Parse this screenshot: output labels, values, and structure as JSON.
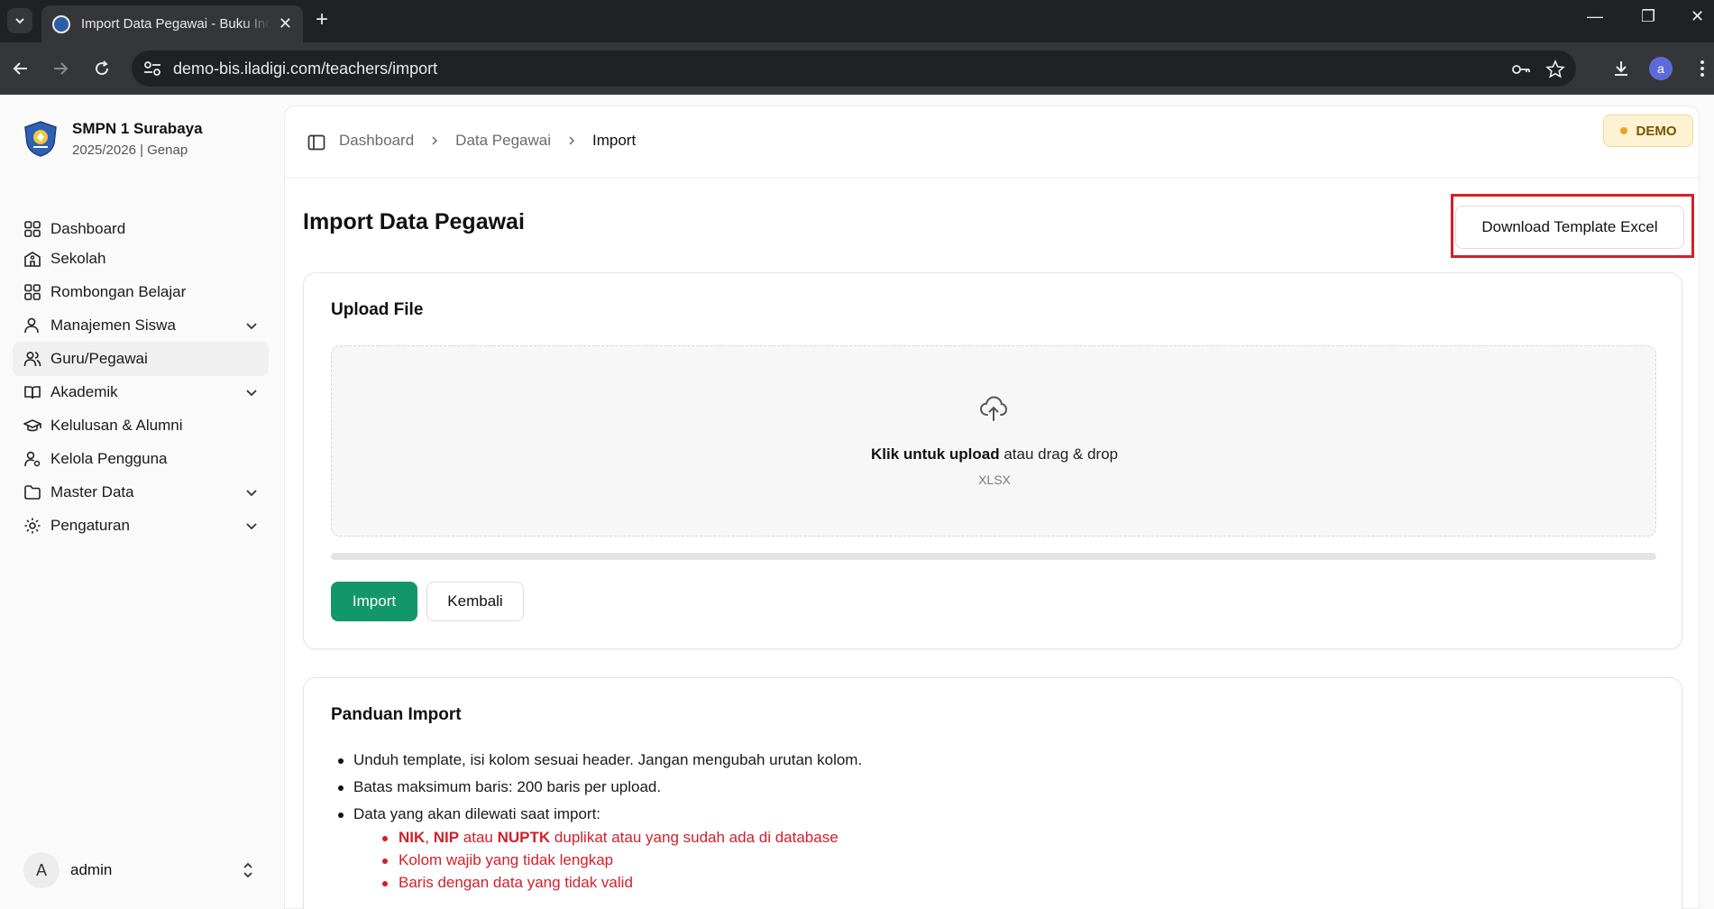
{
  "browser": {
    "tab_title": "Import Data Pegawai - Buku Induk",
    "url": "demo-bis.iladigi.com/teachers/import",
    "profile_initial": "a"
  },
  "sidebar": {
    "school_name": "SMPN 1 Surabaya",
    "school_year": "2025/2026 | Genap",
    "items": [
      {
        "label": "Dashboard",
        "icon": "grid-icon"
      },
      {
        "label": "Sekolah",
        "icon": "school-building-icon"
      },
      {
        "label": "Rombongan Belajar",
        "icon": "grid-icon"
      },
      {
        "label": "Manajemen Siswa",
        "icon": "user-icon",
        "expandable": true
      },
      {
        "label": "Guru/Pegawai",
        "icon": "users-icon",
        "active": true
      },
      {
        "label": "Akademik",
        "icon": "book-open-icon",
        "expandable": true
      },
      {
        "label": "Kelulusan & Alumni",
        "icon": "graduation-cap-icon"
      },
      {
        "label": "Kelola Pengguna",
        "icon": "user-cog-icon"
      },
      {
        "label": "Master Data",
        "icon": "folder-icon",
        "expandable": true
      },
      {
        "label": "Pengaturan",
        "icon": "gear-icon",
        "expandable": true
      }
    ],
    "user": {
      "initial": "A",
      "name": "admin"
    }
  },
  "header": {
    "breadcrumb": [
      "Dashboard",
      "Data Pegawai",
      "Import"
    ],
    "badge": "DEMO"
  },
  "page": {
    "title": "Import Data Pegawai",
    "download_label": "Download Template Excel"
  },
  "upload": {
    "title": "Upload File",
    "click_text": "Klik untuk upload",
    "drag_text": " atau drag & drop",
    "format": "XLSX",
    "progress": 0,
    "import_label": "Import",
    "back_label": "Kembali"
  },
  "guide": {
    "title": "Panduan Import",
    "items": [
      "Unduh template, isi kolom sesuai header. Jangan mengubah urutan kolom.",
      "Batas maksimum baris: 200 baris per upload.",
      "Data yang akan dilewati saat import:"
    ],
    "skip": {
      "nik": "NIK",
      "comma": ", ",
      "nip": "NIP",
      "atau": " atau ",
      "nuptk": "NUPTK",
      "rest": " duplikat atau yang sudah ada di database",
      "incomplete": "Kolom wajib yang tidak lengkap",
      "invalid": "Baris dengan data yang tidak valid"
    }
  },
  "colors": {
    "accent_green": "#13976a",
    "error_red": "#d21f2b",
    "highlight_red": "#d42027",
    "demo_bg": "#fdf3d3"
  }
}
